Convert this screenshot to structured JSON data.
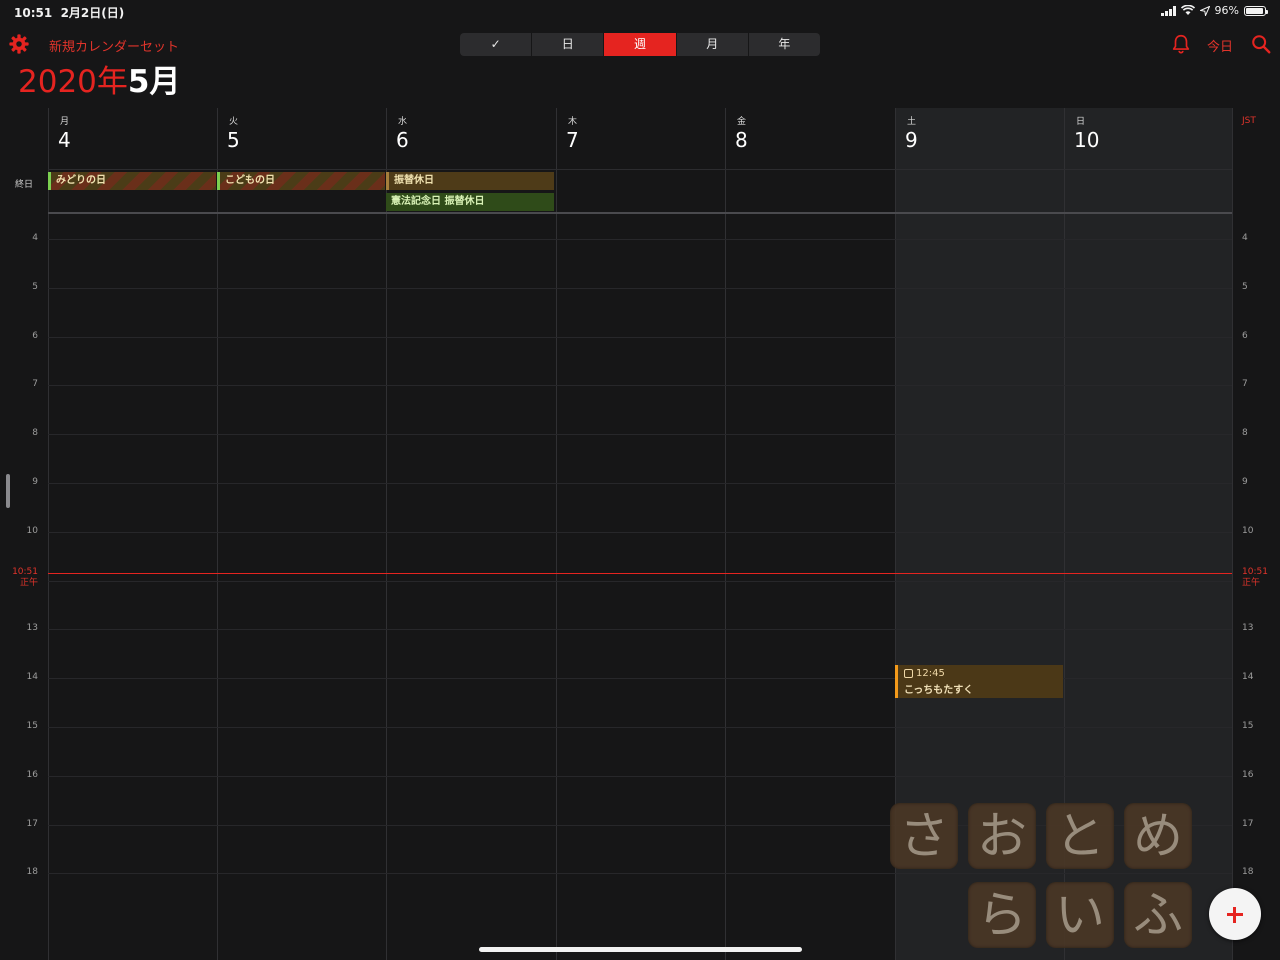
{
  "status_bar": {
    "time": "10:51",
    "date": "2月2日(日)",
    "battery": "96%",
    "battery_level": 0.96
  },
  "toolbar": {
    "calendar_set": "新規カレンダーセット",
    "view_tabs": [
      {
        "label": "✓",
        "name": "tab-checklist",
        "active": false
      },
      {
        "label": "日",
        "name": "tab-day",
        "active": false
      },
      {
        "label": "週",
        "name": "tab-week",
        "active": true
      },
      {
        "label": "月",
        "name": "tab-month",
        "active": false
      },
      {
        "label": "年",
        "name": "tab-year",
        "active": false
      }
    ],
    "today_label": "今日",
    "icons": {
      "settings": "gear-icon",
      "notifications": "bell-icon",
      "search": "search-icon"
    }
  },
  "header": {
    "year": "2020年",
    "month": "5月"
  },
  "week": {
    "timezone": "JST",
    "allday_label": "終日",
    "days": [
      {
        "weekday": "月",
        "day": "4"
      },
      {
        "weekday": "火",
        "day": "5"
      },
      {
        "weekday": "水",
        "day": "6"
      },
      {
        "weekday": "木",
        "day": "7"
      },
      {
        "weekday": "金",
        "day": "8"
      },
      {
        "weekday": "土",
        "day": "9"
      },
      {
        "weekday": "日",
        "day": "10"
      }
    ],
    "hours": [
      "4",
      "5",
      "6",
      "7",
      "8",
      "9",
      "10",
      "正午",
      "13",
      "14",
      "15",
      "16",
      "17",
      "18"
    ],
    "current_time": "10:51"
  },
  "allday_events": [
    {
      "title": "みどりの日",
      "day_index": 0,
      "row": 0,
      "style": "striped"
    },
    {
      "title": "こどもの日",
      "day_index": 1,
      "row": 0,
      "style": "striped"
    },
    {
      "title": "振替休日",
      "day_index": 2,
      "row": 0,
      "style": "brown"
    },
    {
      "title": "憲法記念日 振替休日",
      "day_index": 2,
      "row": 1,
      "style": "green"
    }
  ],
  "timed_events": [
    {
      "time": "12:45",
      "title": "こっちもたすく",
      "day_index": 5
    }
  ],
  "sticker": {
    "row1": [
      "さ",
      "お",
      "と",
      "め"
    ],
    "row2": [
      "ら",
      "い",
      "ふ"
    ]
  },
  "colors": {
    "accent": "#e52420",
    "background": "#161617",
    "weekend": "#222325",
    "event_orange": "#f39a1b",
    "holiday_green": "#7bd050"
  }
}
